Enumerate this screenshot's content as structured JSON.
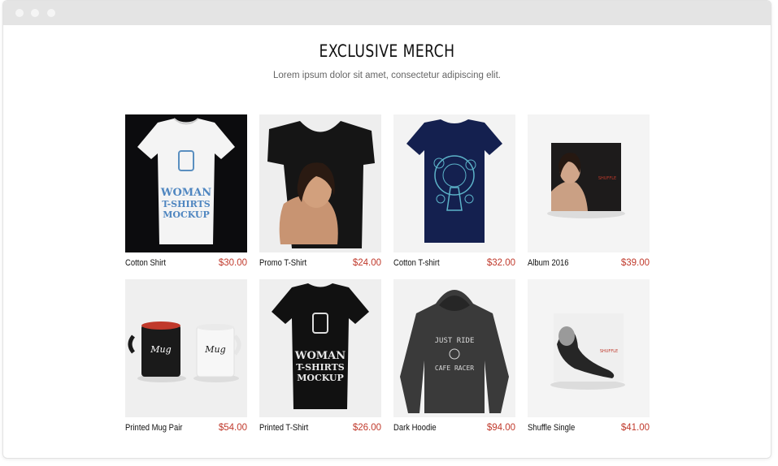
{
  "page": {
    "heading": "EXCLUSIVE MERCH",
    "subtitle": "Lorem ipsum dolor sit amet, consectetur adipiscing elit."
  },
  "colors": {
    "price": "#c0392b",
    "titlebar": "#e4e4e4"
  },
  "products": [
    {
      "name": "Cotton Shirt",
      "price": "$30.00",
      "image": "white-womans-tshirt",
      "print_text": [
        "WOMAN",
        "T-SHIRTS",
        "MOCKUP"
      ]
    },
    {
      "name": "Promo T-Shirt",
      "price": "$24.00",
      "image": "woman-in-black-tshirt"
    },
    {
      "name": "Cotton T-shirt",
      "price": "$32.00",
      "image": "navy-graphic-tshirt"
    },
    {
      "name": "Album 2016",
      "price": "$39.00",
      "image": "album-cover",
      "print_text": [
        "SHUFFLE"
      ]
    },
    {
      "name": "Printed Mug Pair",
      "price": "$54.00",
      "image": "mug-pair",
      "print_text": [
        "Mug",
        "Mug"
      ]
    },
    {
      "name": "Printed T-Shirt",
      "price": "$26.00",
      "image": "black-womans-tshirt",
      "print_text": [
        "WOMAN",
        "T-SHIRTS",
        "MOCKUP"
      ]
    },
    {
      "name": "Dark Hoodie",
      "price": "$94.00",
      "image": "dark-hoodie",
      "print_text": [
        "JUST RIDE",
        "CAFE RACER"
      ]
    },
    {
      "name": "Shuffle Single",
      "price": "$41.00",
      "image": "single-cover",
      "print_text": [
        "SHUFFLE"
      ]
    }
  ]
}
